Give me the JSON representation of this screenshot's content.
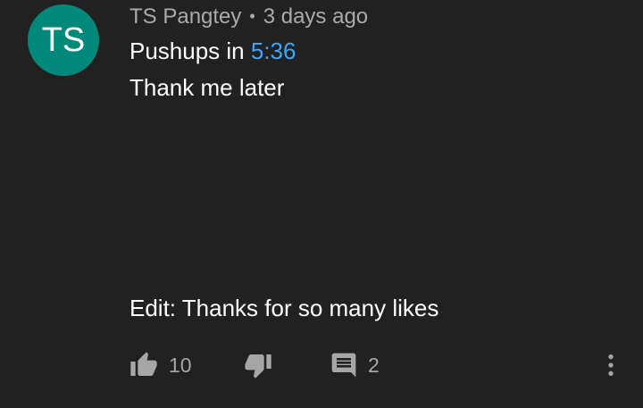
{
  "comment": {
    "avatar_initials": "TS",
    "avatar_color": "#00897b",
    "author": "TS Pangtey",
    "separator": "•",
    "age": "3 days ago",
    "line1_prefix": "Pushups in ",
    "line1_timestamp": "5:36",
    "line2": "Thank me later",
    "line3": "Edit: Thanks for so many likes"
  },
  "actions": {
    "like_icon": "thumbs-up-icon",
    "like_count": "10",
    "dislike_icon": "thumbs-down-icon",
    "reply_icon": "comment-icon",
    "reply_count": "2",
    "menu_icon": "more-vertical-icon"
  },
  "colors": {
    "background": "#212121",
    "text": "#ffffff",
    "meta_text": "#aaaaaa",
    "link": "#3ea6ff",
    "icon": "#a6a6a6"
  }
}
